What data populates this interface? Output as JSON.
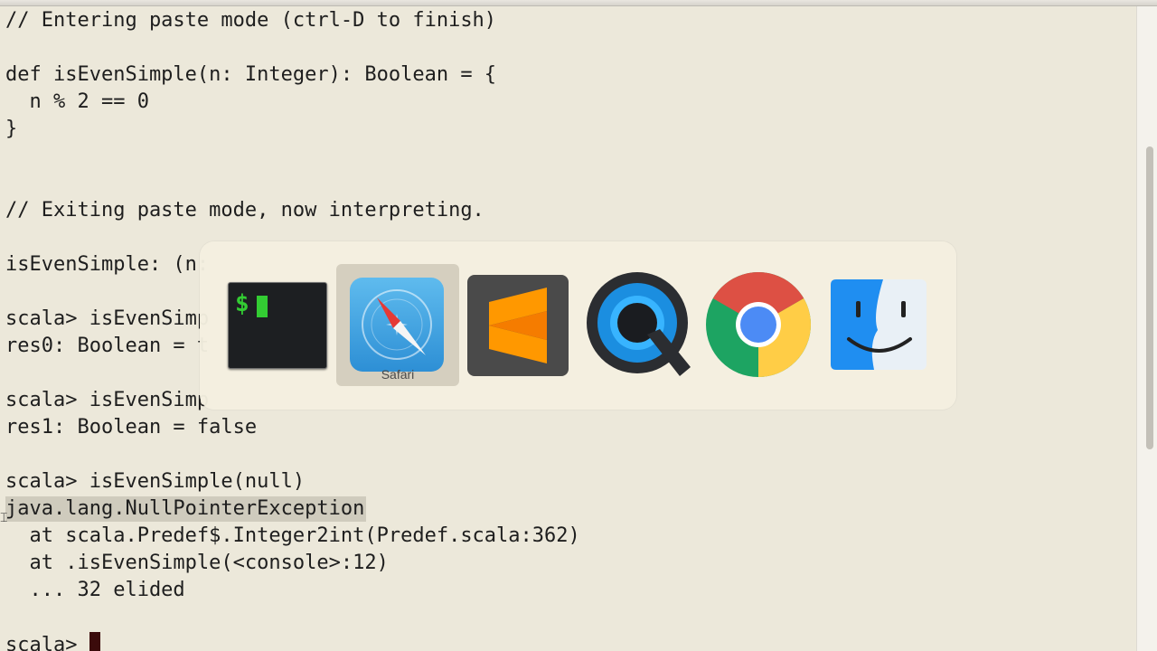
{
  "terminal": {
    "lines": [
      "// Entering paste mode (ctrl-D to finish)",
      "def isEvenSimple(n: Integer): Boolean = {",
      "  n % 2 == 0",
      "}",
      "// Exiting paste mode, now interpreting.",
      "isEvenSimple: (n:",
      "scala> isEvenSimp",
      "res0: Boolean = t",
      "scala> isEvenSimp",
      "res1: Boolean = false",
      "scala> isEvenSimple(null)",
      "java.lang.NullPointerException",
      "  at scala.Predef$.Integer2int(Predef.scala:362)",
      "  at .isEvenSimple(<console>:12)",
      "  ... 32 elided",
      "scala> "
    ]
  },
  "app_switcher": {
    "selected_label": "Safari",
    "apps": [
      {
        "name": "Terminal",
        "icon": "terminal-icon"
      },
      {
        "name": "Safari",
        "icon": "safari-icon"
      },
      {
        "name": "Sublime Text",
        "icon": "sublime-text-icon"
      },
      {
        "name": "QuickTime Player",
        "icon": "quicktime-icon"
      },
      {
        "name": "Google Chrome",
        "icon": "chrome-icon"
      },
      {
        "name": "Finder",
        "icon": "finder-icon"
      }
    ]
  },
  "colors": {
    "terminal_background": "#ece8da",
    "terminal_text": "#1e1e1e",
    "selection_highlight": "#cfcbbd",
    "cursor": "#3b0b0b"
  }
}
